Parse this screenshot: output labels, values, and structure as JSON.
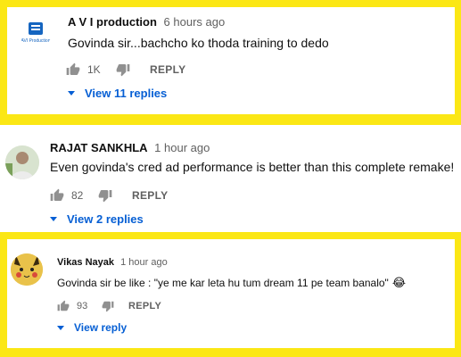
{
  "comments": [
    {
      "author": "A V I production",
      "time": "6 hours ago",
      "text": "Govinda sir...bachcho ko thoda training to dedo",
      "likes": "1K",
      "reply_label": "REPLY",
      "replies_label": "View 11 replies",
      "avatar_icon": "avi-production-logo",
      "avatar_logo_text": "AVI Production"
    },
    {
      "author": "RAJAT SANKHLA",
      "time": "1 hour ago",
      "text": "Even govinda's cred ad performance is better than this complete remake!",
      "likes": "82",
      "reply_label": "REPLY",
      "replies_label": "View 2 replies",
      "avatar_icon": "profile-photo"
    },
    {
      "author": "Vikas Nayak",
      "time": "1 hour ago",
      "text": "Govinda sir be like : \"ye me kar leta hu tum dream 11 pe team banalo\"",
      "emoji": "😂",
      "likes": "93",
      "reply_label": "REPLY",
      "replies_label": "View reply",
      "avatar_icon": "pikachu-avatar"
    }
  ],
  "colors": {
    "frame": "#fbe715",
    "link": "#065fd4",
    "secondary_text": "#606060",
    "primary_text": "#0f0f0f"
  }
}
